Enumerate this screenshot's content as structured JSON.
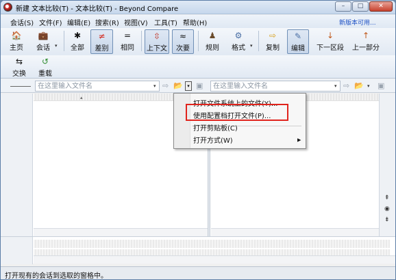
{
  "window": {
    "title": "新建 文本比较(T) - 文本比较(T) - Beyond Compare"
  },
  "window_controls": {
    "minimize": "–",
    "maximize": "□",
    "close": "✕"
  },
  "menu": {
    "items": [
      "会话(S)",
      "文件(F)",
      "编辑(E)",
      "搜索(R)",
      "视图(V)",
      "工具(T)",
      "帮助(H)"
    ],
    "new_version_link": "新版本可用..."
  },
  "toolbar1": {
    "home": "主页",
    "session": "会话",
    "all": "全部",
    "diff": "差别",
    "same": "相同",
    "updown": "上下文",
    "minor": "次要",
    "rules": "规则",
    "format": "格式",
    "copy": "复制",
    "edit": "编辑",
    "next_section": "下一区段",
    "prev_section": "上一部分"
  },
  "toolbar2": {
    "swap": "交换",
    "reload": "重载"
  },
  "pathbar": {
    "left_placeholder": "在这里输入文件名",
    "right_placeholder": "在这里输入文件名"
  },
  "context_menu": {
    "items": [
      "打开文件系统上的文件(Y)...",
      "使用配置档打开文件(P)...",
      "打开剪贴板(C)",
      "打开方式(W)"
    ],
    "submenu_arrow": "▶",
    "highlight_color": "#e0231c"
  },
  "icons": {
    "home": "🏠",
    "session": "💼",
    "all": "✱",
    "diff": "≠",
    "same": "=",
    "updown": "⇳",
    "minor": "≈",
    "rules": "♟",
    "format": "⚙",
    "copy": "⇨",
    "edit": "✎",
    "next_section": "↓",
    "prev_section": "↑",
    "swap": "⇆",
    "reload": "↺",
    "folder": "📂",
    "dropdown": "▾",
    "save": "▣"
  },
  "status": {
    "text": "打开现有的会话到选取的窗格中。"
  }
}
